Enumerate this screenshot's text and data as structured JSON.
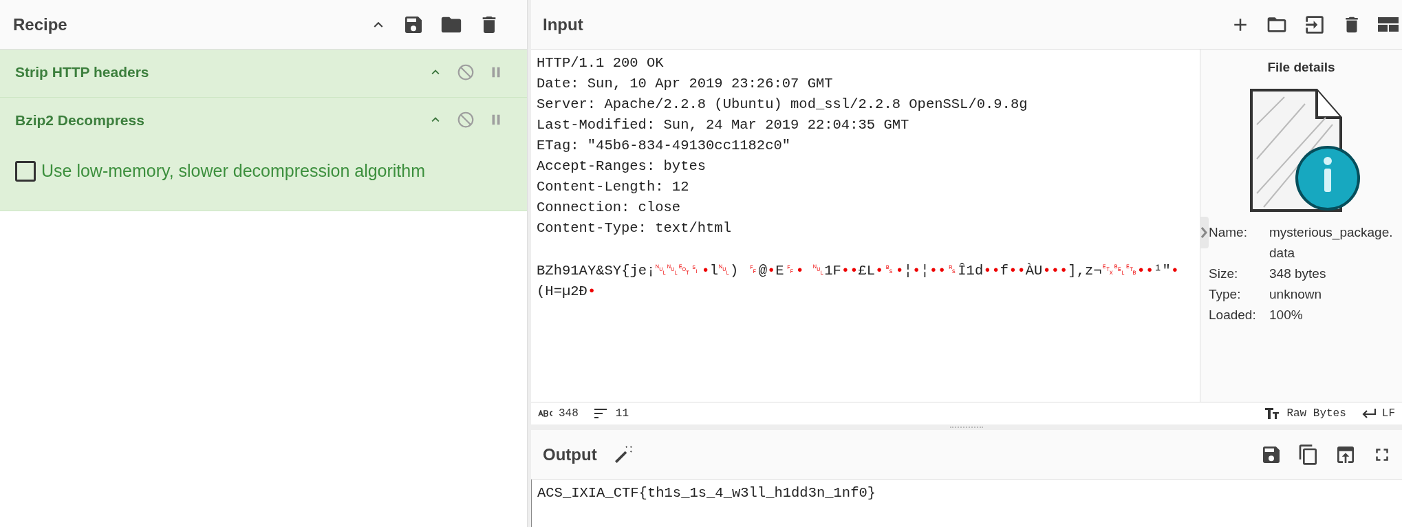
{
  "recipe": {
    "title": "Recipe",
    "operations": [
      {
        "name": "Strip HTTP headers"
      },
      {
        "name": "Bzip2 Decompress",
        "options": [
          {
            "kind": "checkbox",
            "label": "Use low-memory, slower decompression algorithm",
            "checked": false
          }
        ]
      }
    ]
  },
  "input": {
    "title": "Input",
    "header_lines": [
      "HTTP/1.1 200 OK",
      "Date: Sun, 10 Apr 2019 23:26:07 GMT",
      "Server: Apache/2.2.8 (Ubuntu) mod_ssl/2.2.8 OpenSSL/0.9.8g",
      "Last-Modified: Sun, 24 Mar 2019 22:04:35 GMT",
      "ETag: \"45b6-834-49130cc1182c0\"",
      "Accept-Ranges: bytes",
      "Content-Length: 12",
      "Connection: close",
      "Content-Type: text/html"
    ],
    "body_lines": [
      "BZh91AY&SY{je¡␀␀␄␏•l␀) ␌@•E␌• ␀1F••£L•␈•¦•¦••␞Î1d••f••ÀU•••],z¬␃␇␗••¹\"•",
      "(H=µ2Ð•"
    ],
    "file_details": {
      "title": "File details",
      "fields": [
        {
          "label": "Name:",
          "value": "mysterious_package.data"
        },
        {
          "label": "Size:",
          "value": "348 bytes"
        },
        {
          "label": "Type:",
          "value": "unknown"
        },
        {
          "label": "Loaded:",
          "value": "100%"
        }
      ]
    },
    "status": {
      "length": "348",
      "lines": "11",
      "encoding": "Raw Bytes",
      "eol": "LF"
    }
  },
  "output": {
    "title": "Output",
    "lines": [
      "ACS_IXIA_CTF{th1s_1s_4_w3ll_h1dd3n_1nf0}"
    ]
  }
}
